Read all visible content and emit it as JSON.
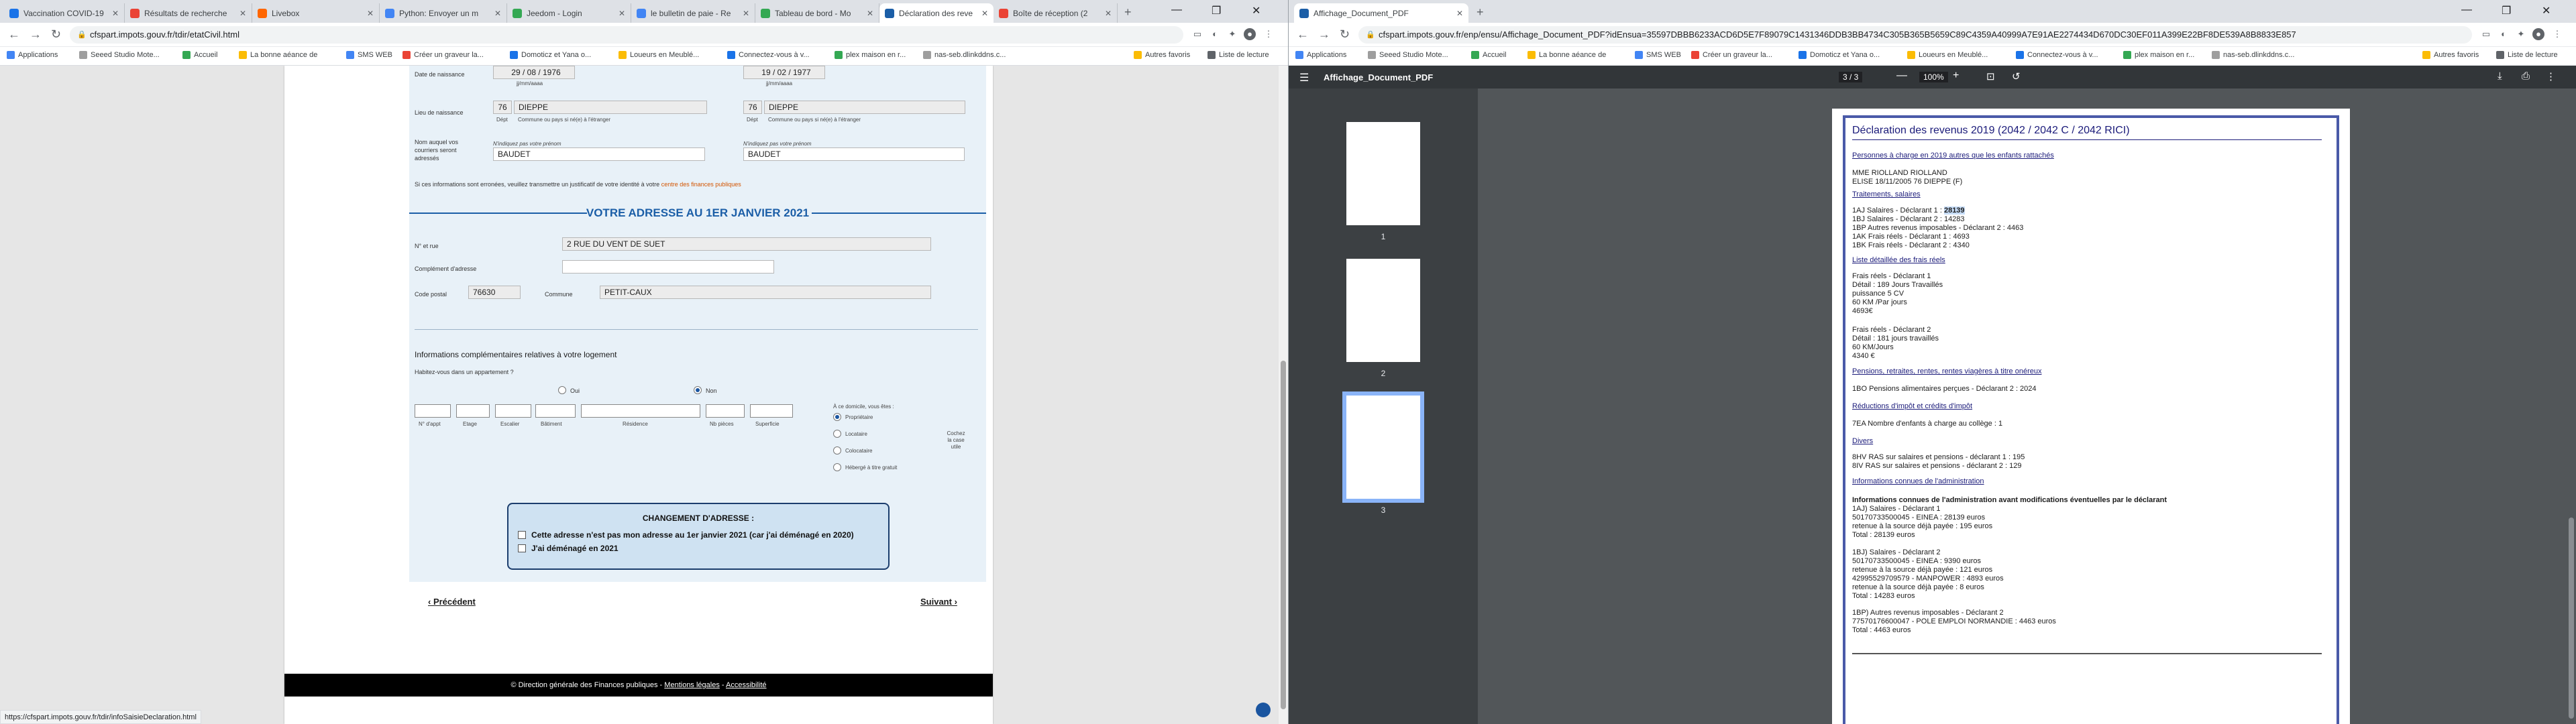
{
  "left": {
    "tabs": [
      {
        "title": "Vaccination COVID-19",
        "color": "#1a73e8"
      },
      {
        "title": "Résultats de recherche",
        "color": "#ea4335"
      },
      {
        "title": "Livebox",
        "color": "#ff6600"
      },
      {
        "title": "Python: Envoyer un m",
        "color": "#4285f4"
      },
      {
        "title": "Jeedom - Login",
        "color": "#34a853"
      },
      {
        "title": "le bulletin de paie - Re",
        "color": "#4285f4"
      },
      {
        "title": "Tableau de bord - Mo",
        "color": "#34a853"
      },
      {
        "title": "Déclaration des reve",
        "color": "#1b5ea7"
      },
      {
        "title": "Boîte de réception (2",
        "color": "#ea4335"
      }
    ],
    "url": "cfspart.impots.gouv.fr/tdir/etatCivil.html",
    "bookmarks": [
      "Applications",
      "Seeed Studio Mote...",
      "Accueil",
      "La bonne aéance de",
      "SMS WEB",
      "Créer un graveur la...",
      "Domoticz et Yana o...",
      "Loueurs en Meublé...",
      "Connectez-vous à v...",
      "plex maison en r...",
      "nas-seb.dlinkddns.c..."
    ],
    "bookmarks_right": [
      "Autres favoris",
      "Liste de lecture"
    ],
    "status_url": "https://cfspart.impots.gouv.fr/tdir/infoSaisieDeclaration.html"
  },
  "form": {
    "birthdate_label": "Date de naissance",
    "birthdate_1": "29 / 08 / 1976",
    "birthdate_2": "19 / 02 / 1977",
    "jjmmaaaa": "jj/mm/aaaa",
    "birthplace_label": "Lieu de naissance",
    "dept_1": "76",
    "commune_1": "DIEPPE",
    "dept_2": "76",
    "commune_2": "DIEPPE",
    "dept_label": "Dépt",
    "commune_label": "Commune ou pays si né(e) à l'étranger",
    "name_label": "Nom auquel vos courriers seront adressés",
    "no_prenom": "N'indiquez pas votre prénom",
    "name_1": "BAUDET",
    "name_2": "BAUDET",
    "info_text": "Si ces informations sont erronées, veuillez transmettre un justificatif de votre identité à votre",
    "info_link": "centre des finances publiques",
    "address_title": "VOTRE ADRESSE AU 1ER JANVIER 2021",
    "street_label": "N° et rue",
    "street_value": "2 RUE DU VENT DE SUET",
    "complement_label": "Complément d'adresse",
    "postal_label": "Code postal",
    "postal_value": "76630",
    "commune_label2": "Commune",
    "commune_value": "PETIT-CAUX",
    "extra_title": "Informations complémentaires relatives à votre logement",
    "apartment_q": "Habitez-vous dans un appartement ?",
    "oui": "Oui",
    "non": "Non",
    "cols": [
      "N° d'appt",
      "Etage",
      "Escalier",
      "Bâtiment",
      "Résidence",
      "Nb pièces",
      "Superficie"
    ],
    "domicile_q": "À ce domicile, vous êtes :",
    "domicile_opts": [
      "Propriétaire",
      "Locataire",
      "Colocataire",
      "Hébergé à titre gratuit"
    ],
    "cochez": "Cochez la case utile",
    "change_title": "CHANGEMENT D'ADRESSE :",
    "change_opt1": "Cette adresse n'est pas mon adresse au 1er janvier 2021 (car j'ai déménagé en 2020)",
    "change_opt2": "J'ai déménagé en 2021",
    "prev": "‹ Précédent",
    "next": "Suivant ›",
    "footer": "© Direction générale des Finances publiques -",
    "footer_link1": "Mentions légales",
    "footer_link2": "Accessibilité"
  },
  "right": {
    "tab_title": "Affichage_Document_PDF",
    "url": "cfspart.impots.gouv.fr/enp/ensu/Affichage_Document_PDF?idEnsua=35597DBBB6233ACD6D5E7F89079C1431346DDB3BB4734C305B365B5659C89C4359A40999A7E91AE2274434D670DC30EF011A399E22BF8DE539A8B8833E857",
    "pdf_title": "Affichage_Document_PDF",
    "page_indicator": "3 / 3",
    "zoom": "100%",
    "thumbs": [
      "1",
      "2",
      "3"
    ],
    "doc": {
      "title": "Déclaration des revenus 2019 (2042 / 2042 C / 2042 RICI)",
      "s1": "Personnes à charge en 2019 autres que les enfants rattachés",
      "s1a": "MME RIOLLAND RIOLLAND",
      "s1b": "ELISE 18/11/2005 76 DIEPPE (F)",
      "s2": "Traitements, salaires",
      "s2a": "1AJ Salaires - Déclarant 1  :",
      "s2a_val": "28139",
      "s2b": "1BJ Salaires - Déclarant 2  : 14283",
      "s2c": "1BP Autres revenus imposables - Déclarant 2 : 4463",
      "s2d": "1AK Frais réels - Déclarant 1 : 4693",
      "s2e": "1BK Frais réels - Déclarant 2 : 4340",
      "s3": "Liste détaillée des frais réels",
      "s3a": "Frais réels - Déclarant 1",
      "s3b": "Détail : 189 Jours Travaillés",
      "s3c": "puissance 5 CV",
      "s3d": "60 KM /Par jours",
      "s3e": "4693€",
      "s3f": "Frais réels - Déclarant 2",
      "s3g": "Détail : 181 jours travaillés",
      "s3h": "60 KM/Jours",
      "s3i": "4340 €",
      "s4": "Pensions, retraites, rentes, rentes viagères à titre onéreux",
      "s4a": "1BO Pensions alimentaires perçues - Déclarant 2 : 2024",
      "s5": "Réductions d'impôt et crédits d'impôt",
      "s5a": "7EA Nombre d'enfants à charge au collège : 1",
      "s6": "Divers",
      "s6a": "8HV RAS sur salaires et pensions - déclarant 1 : 195",
      "s6b": "8IV RAS sur salaires et pensions - déclarant 2 : 129",
      "s7": "Informations connues de l'administration",
      "s7a": "Informations connues de l'administration avant modifications éventuelles par le déclarant",
      "s7b": "1AJ) Salaires - Déclarant 1",
      "s7c": "50170733500045 - EINEA : 28139 euros",
      "s7d": "retenue à la source déjà payée : 195 euros",
      "s7e": "Total : 28139 euros",
      "s7f": "1BJ) Salaires - Déclarant 2",
      "s7g": "50170733500045 - EINEA : 9390 euros",
      "s7h": "retenue à la source déjà payée : 121 euros",
      "s7i": "42995529709579 - MANPOWER : 4893 euros",
      "s7j": "retenue à la source déjà payée : 8 euros",
      "s7k": "Total : 14283 euros",
      "s7l": "1BP) Autres revenus imposables - Déclarant 2",
      "s7m": "77570176600047 - POLE EMPLOI NORMANDIE : 4463 euros",
      "s7n": "Total : 4463 euros"
    }
  }
}
